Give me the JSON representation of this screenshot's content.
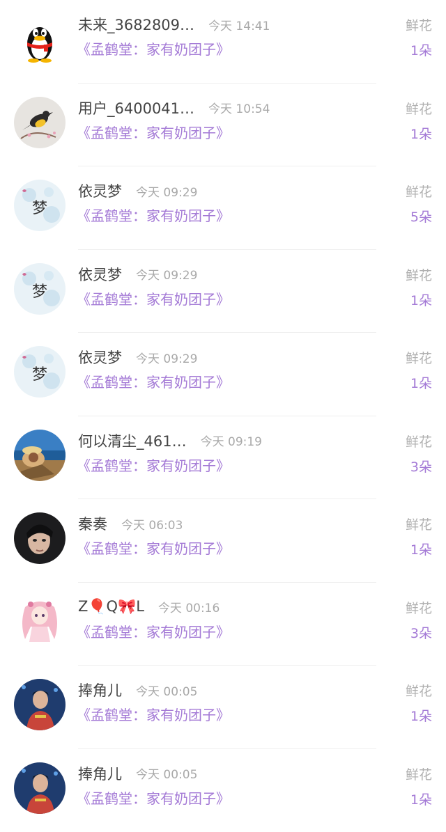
{
  "items": [
    {
      "name": "未来_3682809…",
      "time": "今天 14:41",
      "book": "《孟鹤堂：家有奶团子》",
      "gift": "鲜花",
      "count": "1朵",
      "avatar": "qq-penguin-avatar"
    },
    {
      "name": "用户_6400041…",
      "time": "今天 10:54",
      "book": "《孟鹤堂：家有奶团子》",
      "gift": "鲜花",
      "count": "1朵",
      "avatar": "bird-avatar"
    },
    {
      "name": "依灵梦",
      "time": "今天 09:29",
      "book": "《孟鹤堂：家有奶团子》",
      "gift": "鲜花",
      "count": "5朵",
      "avatar": "meng-character-avatar"
    },
    {
      "name": "依灵梦",
      "time": "今天 09:29",
      "book": "《孟鹤堂：家有奶团子》",
      "gift": "鲜花",
      "count": "1朵",
      "avatar": "meng-character-avatar"
    },
    {
      "name": "依灵梦",
      "time": "今天 09:29",
      "book": "《孟鹤堂：家有奶团子》",
      "gift": "鲜花",
      "count": "1朵",
      "avatar": "meng-character-avatar"
    },
    {
      "name": "何以清尘_461…",
      "time": "今天 09:19",
      "book": "《孟鹤堂：家有奶团子》",
      "gift": "鲜花",
      "count": "3朵",
      "avatar": "seaside-person-avatar"
    },
    {
      "name": "秦奏",
      "time": "今天 06:03",
      "book": "《孟鹤堂：家有奶团子》",
      "gift": "鲜花",
      "count": "1朵",
      "avatar": "portrait-avatar"
    },
    {
      "name": "Z🎈Q🎀L",
      "time": "今天 00:16",
      "book": "《孟鹤堂：家有奶团子》",
      "gift": "鲜花",
      "count": "3朵",
      "avatar": "anime-girl-avatar"
    },
    {
      "name": "捧角儿",
      "time": "今天 00:05",
      "book": "《孟鹤堂：家有奶团子》",
      "gift": "鲜花",
      "count": "1朵",
      "avatar": "performer-avatar"
    },
    {
      "name": "捧角儿",
      "time": "今天 00:05",
      "book": "《孟鹤堂：家有奶团子》",
      "gift": "鲜花",
      "count": "1朵",
      "avatar": "performer-avatar"
    }
  ],
  "colors": {
    "name": "#444444",
    "time": "#a9a9a9",
    "accent": "#a47ad6",
    "gift_label": "#b0b0b0"
  }
}
